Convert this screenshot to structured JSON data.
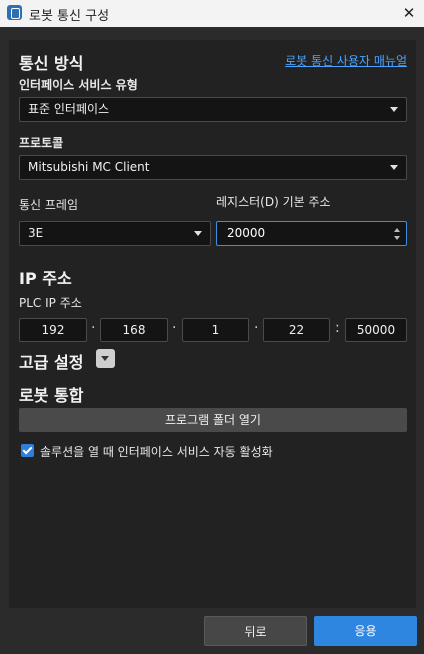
{
  "window": {
    "title": "로봇 통신 구성",
    "close_icon": "close-icon"
  },
  "comm_method": {
    "heading": "통신 방식",
    "manual_link": "로봇 통신 사용자 매뉴얼",
    "interface_type_label": "인터페이스 서비스 유형",
    "interface_type_value": "표준 인터페이스",
    "protocol_label": "프로토콜",
    "protocol_value": "Mitsubishi MC Client",
    "frame_label": "통신 프레임",
    "frame_value": "3E",
    "register_label": "레지스터(D) 기본 주소",
    "register_value": "20000"
  },
  "ip": {
    "heading": "IP 주소",
    "plc_label": "PLC IP 주소",
    "octets": [
      "192",
      "168",
      "1",
      "22"
    ],
    "port": "50000",
    "dot": "·",
    "colon": ":"
  },
  "advanced": {
    "heading": "고급 설정"
  },
  "robot_integration": {
    "heading": "로봇 통합",
    "open_folder_button": "프로그램 폴더 열기",
    "auto_activate_label": "솔루션을 열 때 인터페이스 서비스 자동 활성화",
    "auto_activate_checked": true
  },
  "footer": {
    "back_button": "뒤로",
    "apply_button": "응용"
  },
  "colors": {
    "accent": "#2f86e0",
    "link": "#4aa3ff",
    "panel": "#222222",
    "window": "#2b2b2b"
  }
}
